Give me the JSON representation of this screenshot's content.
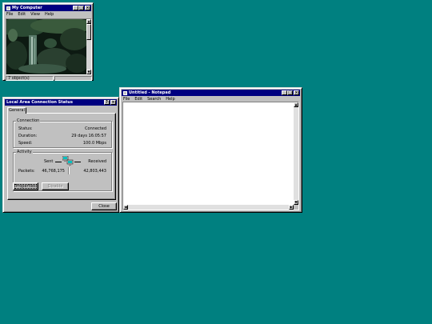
{
  "my_computer": {
    "title": "My Computer",
    "menu": [
      "File",
      "Edit",
      "View",
      "Help"
    ],
    "status_text": "7 object(s)"
  },
  "notepad": {
    "title": "Untitled - Notepad",
    "menu": [
      "File",
      "Edit",
      "Search",
      "Help"
    ],
    "content": ""
  },
  "lac_status": {
    "title": "Local Area Connection Status",
    "tab": "General",
    "connection": {
      "group_label": "Connection",
      "status_label": "Status:",
      "status_value": "Connected",
      "duration_label": "Duration:",
      "duration_value": "29 days 16:05:57",
      "speed_label": "Speed:",
      "speed_value": "100.0 Mbps"
    },
    "activity": {
      "group_label": "Activity",
      "sent_label": "Sent",
      "received_label": "Received",
      "packets_label": "Packets:",
      "packets_sent": "46,768,175",
      "packets_received": "42,803,443"
    },
    "properties_button": "Properties",
    "disable_button": "Disable",
    "close_button": "Close"
  },
  "titlebar_buttons": {
    "minimize": "_",
    "maximize": "□",
    "close": "×",
    "help": "?"
  },
  "colors": {
    "desktop": "#008080",
    "titlebar": "#000080",
    "face": "#c0c0c0"
  }
}
